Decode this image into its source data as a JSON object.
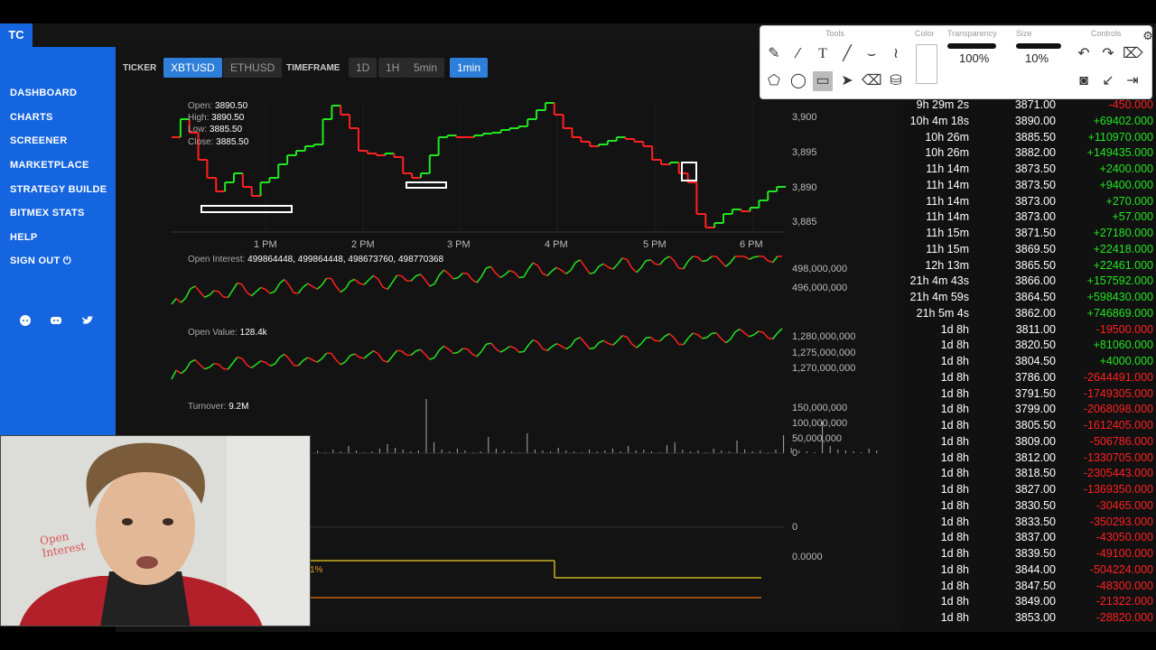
{
  "app": {
    "logo": "TC"
  },
  "sidebar": {
    "items": [
      {
        "label": "DASHBOARD"
      },
      {
        "label": "CHARTS"
      },
      {
        "label": "SCREENER"
      },
      {
        "label": "MARKETPLACE"
      },
      {
        "label": "STRATEGY BUILDE"
      },
      {
        "label": "BITMEX STATS"
      },
      {
        "label": "HELP"
      },
      {
        "label": "SIGN OUT ⏻"
      }
    ],
    "social_icons": [
      "reddit-icon",
      "discord-icon",
      "twitter-icon"
    ]
  },
  "controls": {
    "ticker_label": "TICKER",
    "tickers": [
      {
        "label": "XBTUSD",
        "active": true
      },
      {
        "label": "ETHUSD",
        "active": false
      }
    ],
    "timeframe_label": "TIMEFRAME",
    "timeframes": [
      {
        "label": "1D",
        "active": false
      },
      {
        "label": "1H",
        "active": false
      },
      {
        "label": "5min",
        "active": false
      },
      {
        "label": "1min",
        "active": true
      }
    ]
  },
  "ohlc": {
    "open_label": "Open:",
    "open": "3890.50",
    "high_label": "High:",
    "high": "3890.50",
    "low_label": "Low:",
    "low": "3885.50",
    "close_label": "Close:",
    "close": "3885.50"
  },
  "price_axis": [
    "3,900",
    "3,895",
    "3,890",
    "3,885"
  ],
  "time_axis": [
    "1 PM",
    "2 PM",
    "3 PM",
    "4 PM",
    "5 PM",
    "6 PM"
  ],
  "open_interest": {
    "label": "Open Interest:",
    "value": "499864448, 499864448, 498673760, 498770368",
    "axis": [
      "498,000,000",
      "496,000,000"
    ]
  },
  "open_value": {
    "label": "Open Value:",
    "value": "128.4k",
    "axis": [
      "1,280,000,000",
      "1,275,000,000",
      "1,270,000,000"
    ]
  },
  "turnover": {
    "label": "Turnover:",
    "value": "9.2M",
    "axis": [
      "150,000,000",
      "100,000,000",
      "50,000,000",
      "0"
    ]
  },
  "lower_axis": {
    "zero": "0",
    "zero_dec": "0.0000",
    "pct_label": "1%"
  },
  "toolbox": {
    "sections": {
      "tools": "Tools",
      "color": "Color",
      "transparency": "Transparency",
      "size": "Size",
      "controls": "Controls"
    },
    "transparency_value": "100%",
    "size_value": "10%"
  },
  "colors": {
    "accent": "#1565e0",
    "positive": "#22e622",
    "negative": "#ff2020",
    "active_btn": "#2d7fd9"
  },
  "trades": [
    {
      "time": "9h 29m 2s",
      "price": "3871.00",
      "change": "-450.000",
      "dir": "neg"
    },
    {
      "time": "10h 4m 18s",
      "price": "3890.00",
      "change": "+69402.000",
      "dir": "pos"
    },
    {
      "time": "10h 26m",
      "price": "3885.50",
      "change": "+110970.000",
      "dir": "pos"
    },
    {
      "time": "10h 26m",
      "price": "3882.00",
      "change": "+149435.000",
      "dir": "pos"
    },
    {
      "time": "11h 14m",
      "price": "3873.50",
      "change": "+2400.000",
      "dir": "pos"
    },
    {
      "time": "11h 14m",
      "price": "3873.50",
      "change": "+9400.000",
      "dir": "pos"
    },
    {
      "time": "11h 14m",
      "price": "3873.00",
      "change": "+270.000",
      "dir": "pos"
    },
    {
      "time": "11h 14m",
      "price": "3873.00",
      "change": "+57.000",
      "dir": "pos"
    },
    {
      "time": "11h 15m",
      "price": "3871.50",
      "change": "+27180.000",
      "dir": "pos"
    },
    {
      "time": "11h 15m",
      "price": "3869.50",
      "change": "+22418.000",
      "dir": "pos"
    },
    {
      "time": "12h 13m",
      "price": "3865.50",
      "change": "+22461.000",
      "dir": "pos"
    },
    {
      "time": "21h 4m 43s",
      "price": "3866.00",
      "change": "+157592.000",
      "dir": "pos"
    },
    {
      "time": "21h 4m 59s",
      "price": "3864.50",
      "change": "+598430.000",
      "dir": "pos"
    },
    {
      "time": "21h 5m 4s",
      "price": "3862.00",
      "change": "+746869.000",
      "dir": "pos"
    },
    {
      "time": "1d 8h",
      "price": "3811.00",
      "change": "-19500.000",
      "dir": "neg"
    },
    {
      "time": "1d 8h",
      "price": "3820.50",
      "change": "+81060.000",
      "dir": "pos"
    },
    {
      "time": "1d 8h",
      "price": "3804.50",
      "change": "+4000.000",
      "dir": "pos"
    },
    {
      "time": "1d 8h",
      "price": "3786.00",
      "change": "-2644491.000",
      "dir": "neg"
    },
    {
      "time": "1d 8h",
      "price": "3791.50",
      "change": "-1749305.000",
      "dir": "neg"
    },
    {
      "time": "1d 8h",
      "price": "3799.00",
      "change": "-2068098.000",
      "dir": "neg"
    },
    {
      "time": "1d 8h",
      "price": "3805.50",
      "change": "-1612405.000",
      "dir": "neg"
    },
    {
      "time": "1d 8h",
      "price": "3809.00",
      "change": "-506786.000",
      "dir": "neg"
    },
    {
      "time": "1d 8h",
      "price": "3812.00",
      "change": "-1330705.000",
      "dir": "neg"
    },
    {
      "time": "1d 8h",
      "price": "3818.50",
      "change": "-2305443.000",
      "dir": "neg"
    },
    {
      "time": "1d 8h",
      "price": "3827.00",
      "change": "-1369350.000",
      "dir": "neg"
    },
    {
      "time": "1d 8h",
      "price": "3830.50",
      "change": "-30465.000",
      "dir": "neg"
    },
    {
      "time": "1d 8h",
      "price": "3833.50",
      "change": "-350293.000",
      "dir": "neg"
    },
    {
      "time": "1d 8h",
      "price": "3837.00",
      "change": "-43050.000",
      "dir": "neg"
    },
    {
      "time": "1d 8h",
      "price": "3839.50",
      "change": "-49100.000",
      "dir": "neg"
    },
    {
      "time": "1d 8h",
      "price": "3844.00",
      "change": "-504224.000",
      "dir": "neg"
    },
    {
      "time": "1d 8h",
      "price": "3847.50",
      "change": "-48300.000",
      "dir": "neg"
    },
    {
      "time": "1d 8h",
      "price": "3849.00",
      "change": "-21322.000",
      "dir": "neg"
    },
    {
      "time": "1d 8h",
      "price": "3853.00",
      "change": "-28820.000",
      "dir": "neg"
    }
  ],
  "webcam": {
    "whiteboard_text": "Open Interest"
  }
}
